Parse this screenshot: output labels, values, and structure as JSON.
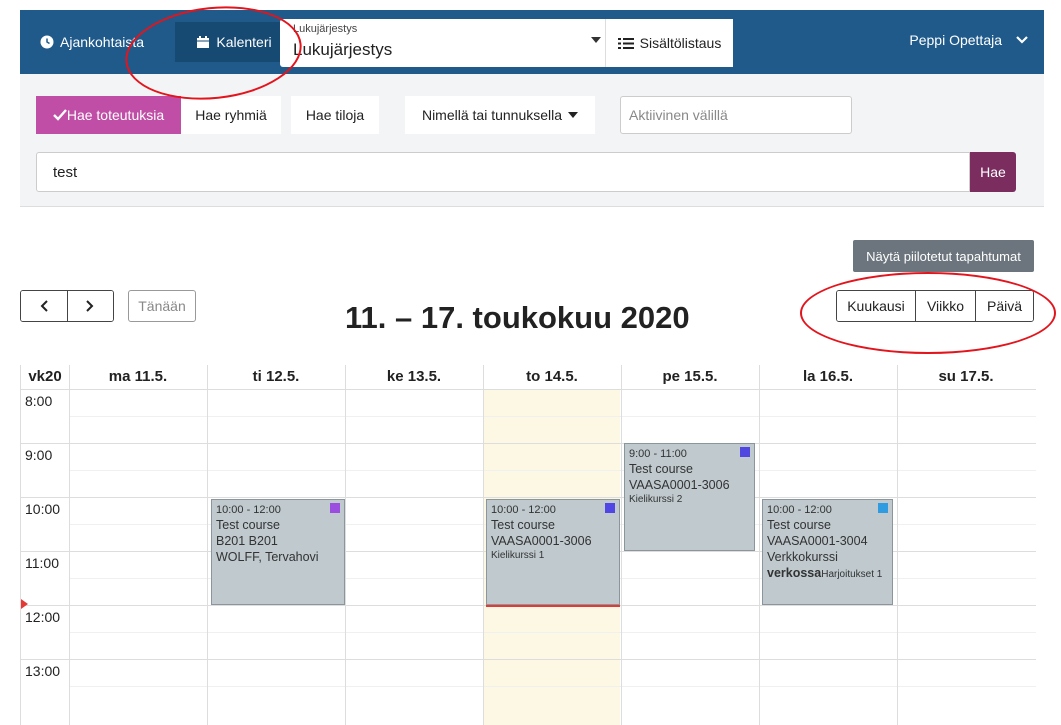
{
  "nav": {
    "news_label": "Ajankohtaista",
    "calendar_label": "Kalenteri",
    "schedule_select_label": "Lukujärjestys",
    "schedule_select_value": "Lukujärjestys",
    "toc_label": "Sisältölistaus",
    "user_name": "Peppi Opettaja"
  },
  "search": {
    "tab_realizations": "Hae toteutuksia",
    "tab_groups": "Hae ryhmiä",
    "tab_rooms": "Hae tiloja",
    "mode_dropdown": "Nimellä tai tunnuksella",
    "active_placeholder": "Aktiivinen välillä",
    "query_value": "test",
    "search_button": "Hae"
  },
  "calendar": {
    "show_hidden_button": "Näytä piilotetut tapahtumat",
    "today_button": "Tänään",
    "range_title": "11. – 17. toukokuu 2020",
    "view_month": "Kuukausi",
    "view_week": "Viikko",
    "view_day": "Päivä",
    "week_label": "vk20",
    "days": [
      "ma 11.5.",
      "ti 12.5.",
      "ke 13.5.",
      "to 14.5.",
      "pe 15.5.",
      "la 16.5.",
      "su 17.5."
    ],
    "times": [
      "8:00",
      "9:00",
      "10:00",
      "11:00",
      "12:00",
      "13:00"
    ],
    "events": [
      {
        "time": "10:00 - 12:00",
        "title": "Test course",
        "line2": "B201 B201",
        "line3": "WOLFF, Tervahovi",
        "color": "#9b4de0"
      },
      {
        "time": "10:00 - 12:00",
        "title": "Test course",
        "line2": "VAASA0001-3006",
        "line3": "Kielikurssi 1",
        "color": "#4f46e5"
      },
      {
        "time": "9:00 - 11:00",
        "title": "Test course",
        "line2": "VAASA0001-3006",
        "line3": "Kielikurssi 2",
        "color": "#5046e0"
      },
      {
        "time": "10:00 - 12:00",
        "title": "Test course",
        "line2": "VAASA0001-3004",
        "line3": "Verkkokurssi",
        "line4a": "verkossa",
        "line4b": "Harjoitukset 1",
        "color": "#2f9be0"
      }
    ]
  },
  "colors": {
    "nav_bg": "#1f5a8a",
    "active_tab": "#c04ea6",
    "search_btn": "#7b2d5f",
    "annotation": "#e3141c"
  }
}
